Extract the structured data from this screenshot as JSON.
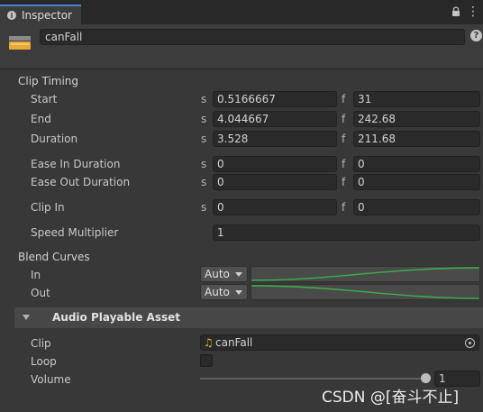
{
  "tab": {
    "label": "Inspector"
  },
  "header": {
    "object_name": "canFall"
  },
  "clip_timing": {
    "title": "Clip Timing",
    "rows": [
      {
        "label": "Start",
        "s_label": "s",
        "s_value": "0.5166667",
        "f_label": "f",
        "f_value": "31"
      },
      {
        "label": "End",
        "s_label": "s",
        "s_value": "4.044667",
        "f_label": "f",
        "f_value": "242.68"
      },
      {
        "label": "Duration",
        "s_label": "s",
        "s_value": "3.528",
        "f_label": "f",
        "f_value": "211.68"
      },
      {
        "label": "Ease In Duration",
        "s_label": "s",
        "s_value": "0",
        "f_label": "f",
        "f_value": "0"
      },
      {
        "label": "Ease Out Duration",
        "s_label": "s",
        "s_value": "0",
        "f_label": "f",
        "f_value": "0"
      },
      {
        "label": "Clip In",
        "s_label": "s",
        "s_value": "0",
        "f_label": "f",
        "f_value": "0"
      }
    ],
    "speed_multiplier": {
      "label": "Speed Multiplier",
      "value": "1"
    }
  },
  "blend_curves": {
    "title": "Blend Curves",
    "in": {
      "label": "In",
      "mode": "Auto"
    },
    "out": {
      "label": "Out",
      "mode": "Auto"
    },
    "curve_color": "#3cb04a"
  },
  "audio_asset": {
    "title": "Audio Playable Asset",
    "clip": {
      "label": "Clip",
      "value": "canFall",
      "icon": "music-note-icon"
    },
    "loop": {
      "label": "Loop",
      "checked": false
    },
    "volume": {
      "label": "Volume",
      "value": "1",
      "level": 1.0
    }
  },
  "watermark": "CSDN @[奋斗不止]"
}
